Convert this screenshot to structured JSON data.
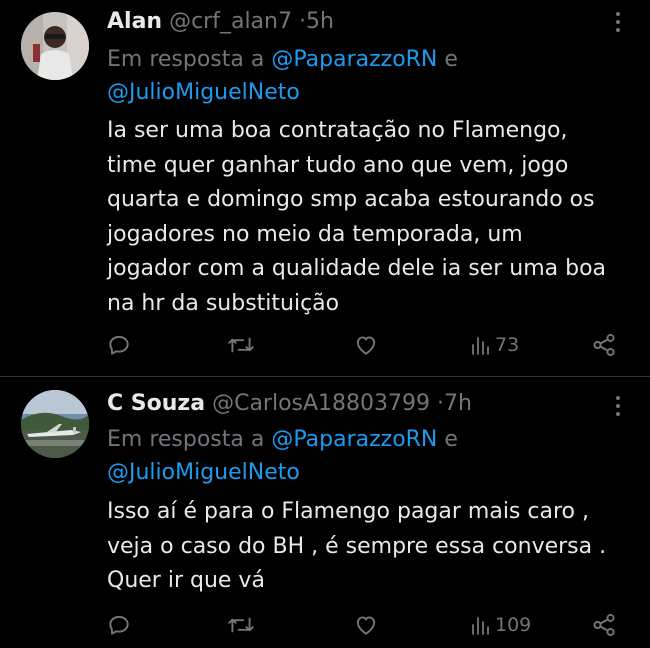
{
  "colors": {
    "background": "#000000",
    "text": "#e7e9ea",
    "muted": "#71767b",
    "link": "#1d9bf0",
    "divider": "#2f3336"
  },
  "tweets": [
    {
      "name": "Alan",
      "handle": "@crf_alan7",
      "separator": "·",
      "time": "5h",
      "reply_prefix": "Em resposta a",
      "reply_to_1": "@PaparazzoRN",
      "reply_conj": "e",
      "reply_to_2": "@JulioMiguelNeto",
      "body_lines": [
        "Ia ser uma boa contratação no Flamengo,",
        "time quer ganhar tudo ano que vem, jogo",
        "quarta e domingo smp acaba estourando os",
        "jogadores no meio da temporada, um",
        "jogador com a qualidade dele ia ser uma boa",
        "na hr da substituição"
      ],
      "views": "73",
      "icons": {
        "reply": "reply-icon",
        "retweet": "retweet-icon",
        "like": "heart-icon",
        "views": "views-icon",
        "share": "share-icon",
        "more": "more-icon"
      }
    },
    {
      "name": "C Souza",
      "handle": "@CarlosA18803799",
      "separator": "·",
      "time": "7h",
      "reply_prefix": "Em resposta a",
      "reply_to_1": "@PaparazzoRN",
      "reply_conj": "e",
      "reply_to_2": "@JulioMiguelNeto",
      "body_lines": [
        "Isso aí é para o Flamengo pagar mais caro  ,",
        "veja o caso do BH , é sempre essa conversa .",
        "Quer ir que vá"
      ],
      "views": "109",
      "icons": {
        "reply": "reply-icon",
        "retweet": "retweet-icon",
        "like": "heart-icon",
        "views": "views-icon",
        "share": "share-icon",
        "more": "more-icon"
      }
    }
  ]
}
